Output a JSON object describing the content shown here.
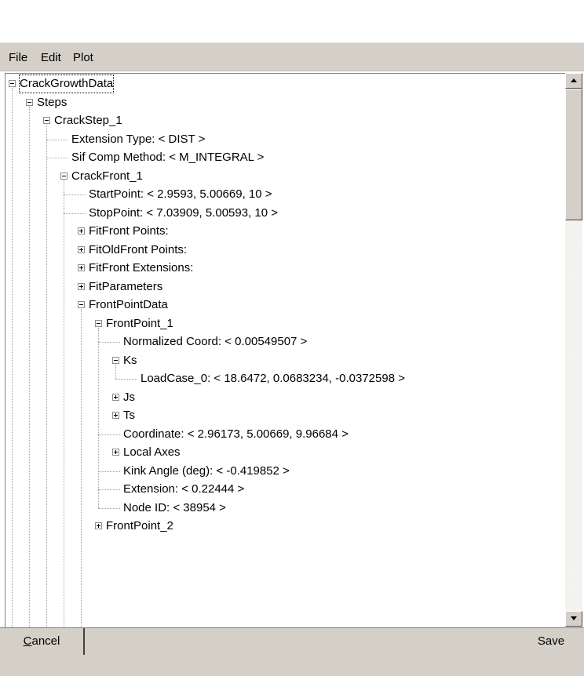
{
  "menu": {
    "file": "File",
    "edit": "Edit",
    "plot": "Plot"
  },
  "tree": {
    "rows": [
      {
        "label": "CrackGrowthData",
        "depth": 0,
        "expander": "minus"
      },
      {
        "label": "Steps",
        "depth": 1,
        "expander": "minus"
      },
      {
        "label": "CrackStep_1",
        "depth": 2,
        "expander": "minus"
      },
      {
        "label": "Extension Type: < DIST >",
        "depth": 3,
        "expander": "none"
      },
      {
        "label": "Sif Comp Method: < M_INTEGRAL >",
        "depth": 3,
        "expander": "none"
      },
      {
        "label": "CrackFront_1",
        "depth": 3,
        "expander": "minus"
      },
      {
        "label": "StartPoint: < 2.9593, 5.00669, 10 >",
        "depth": 4,
        "expander": "none"
      },
      {
        "label": "StopPoint: < 7.03909, 5.00593, 10 >",
        "depth": 4,
        "expander": "none"
      },
      {
        "label": "FitFront Points:",
        "depth": 4,
        "expander": "plus"
      },
      {
        "label": "FitOldFront Points:",
        "depth": 4,
        "expander": "plus"
      },
      {
        "label": "FitFront Extensions:",
        "depth": 4,
        "expander": "plus"
      },
      {
        "label": "FitParameters",
        "depth": 4,
        "expander": "plus"
      },
      {
        "label": "FrontPointData",
        "depth": 4,
        "expander": "minus"
      },
      {
        "label": "FrontPoint_1",
        "depth": 5,
        "expander": "minus"
      },
      {
        "label": "Normalized Coord: < 0.00549507 >",
        "depth": 6,
        "expander": "none"
      },
      {
        "label": "Ks",
        "depth": 6,
        "expander": "minus"
      },
      {
        "label": "LoadCase_0: < 18.6472, 0.0683234, -0.0372598 >",
        "depth": 7,
        "expander": "none"
      },
      {
        "label": "Js",
        "depth": 6,
        "expander": "plus"
      },
      {
        "label": "Ts",
        "depth": 6,
        "expander": "plus"
      },
      {
        "label": "Coordinate: < 2.96173, 5.00669, 9.96684 >",
        "depth": 6,
        "expander": "none"
      },
      {
        "label": "Local Axes",
        "depth": 6,
        "expander": "plus"
      },
      {
        "label": "Kink Angle (deg): < -0.419852 >",
        "depth": 6,
        "expander": "none"
      },
      {
        "label": "Extension: < 0.22444 >",
        "depth": 6,
        "expander": "none"
      },
      {
        "label": "Node ID: < 38954 >",
        "depth": 6,
        "expander": "none"
      },
      {
        "label": "FrontPoint_2",
        "depth": 5,
        "expander": "plus"
      }
    ]
  },
  "buttons": {
    "cancel_first": "C",
    "cancel_rest": "ancel",
    "save": "Save"
  }
}
